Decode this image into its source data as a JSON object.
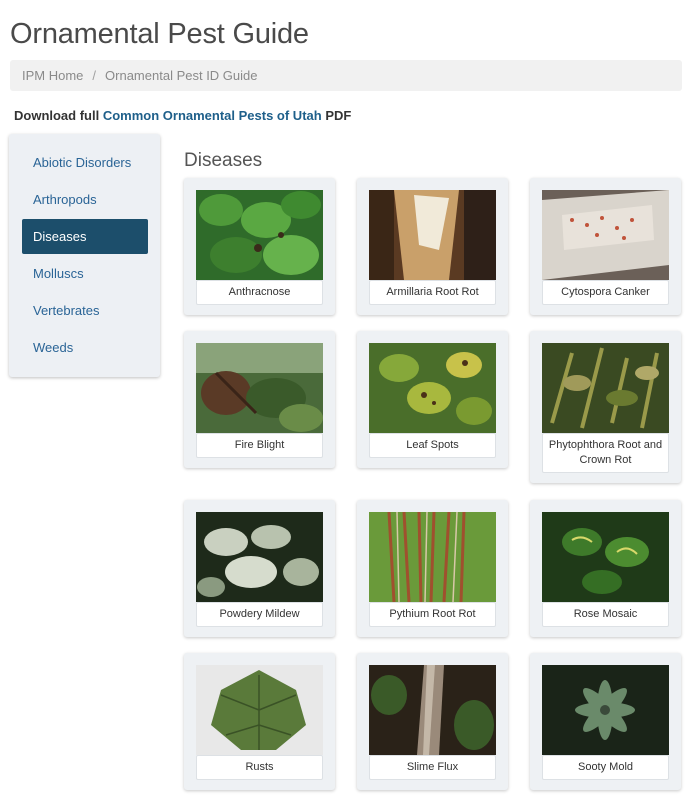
{
  "page": {
    "title": "Ornamental Pest Guide",
    "breadcrumb": [
      "IPM Home",
      "Ornamental Pest ID Guide"
    ],
    "download_prefix": "Download full ",
    "download_link": "Common Ornamental Pests of Utah",
    "download_suffix": " PDF"
  },
  "sidebar": {
    "items": [
      {
        "label": "Abiotic Disorders"
      },
      {
        "label": "Arthropods"
      },
      {
        "label": "Diseases"
      },
      {
        "label": "Molluscs"
      },
      {
        "label": "Vertebrates"
      },
      {
        "label": "Weeds"
      }
    ],
    "active": "Diseases"
  },
  "main": {
    "section_title": "Diseases",
    "cards": [
      {
        "label": "Anthracnose"
      },
      {
        "label": "Armillaria Root Rot"
      },
      {
        "label": "Cytospora Canker"
      },
      {
        "label": "Fire Blight"
      },
      {
        "label": "Leaf Spots"
      },
      {
        "label": "Phytophthora Root and Crown Rot"
      },
      {
        "label": "Powdery Mildew"
      },
      {
        "label": "Pythium Root Rot"
      },
      {
        "label": "Rose Mosaic"
      },
      {
        "label": "Rusts"
      },
      {
        "label": "Slime Flux"
      },
      {
        "label": "Sooty Mold"
      }
    ]
  },
  "colors": {
    "active_nav": "#1c4e6b",
    "link": "#2a6496",
    "sidebar_bg": "#edf0f4"
  }
}
